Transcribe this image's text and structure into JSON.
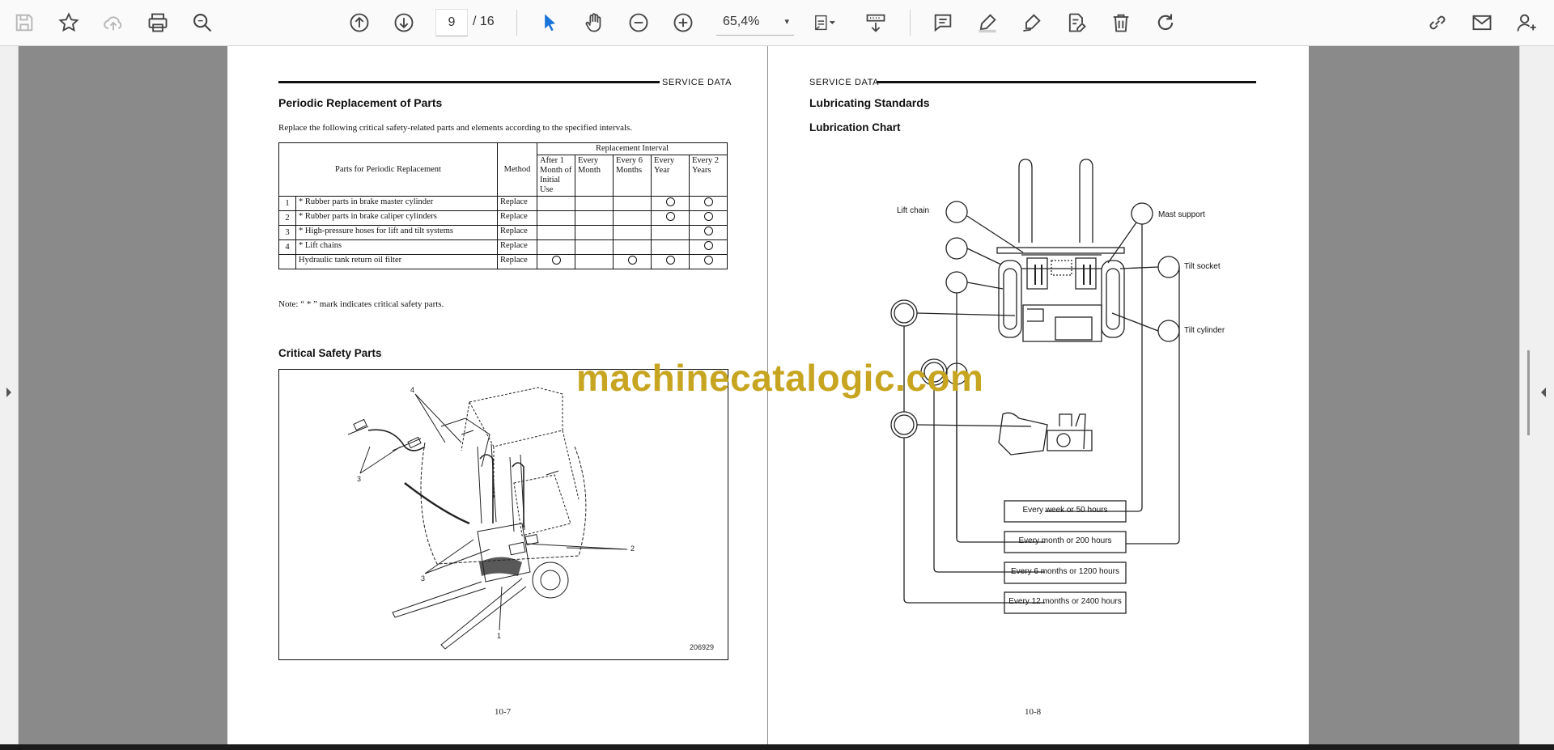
{
  "toolbar": {
    "current_page": "9",
    "page_total": "/  16",
    "zoom": "65,4%",
    "zoom_caret": "▾"
  },
  "left_page": {
    "header": "SERVICE  DATA",
    "title": "Periodic Replacement of Parts",
    "intro": "Replace the following critical safety-related parts and elements according to the specified intervals.",
    "table": {
      "col_parts": "Parts for Periodic Replacement",
      "col_method": "Method",
      "col_interval": "Replacement Interval",
      "intervals": [
        "After 1 Month of Initial Use",
        "Every Month",
        "Every 6 Months",
        "Every Year",
        "Every 2 Years"
      ],
      "rows": [
        {
          "no": "1",
          "part": "* Rubber parts in brake master cylinder",
          "method": "Replace",
          "marks": [
            false,
            false,
            false,
            true,
            true
          ]
        },
        {
          "no": "2",
          "part": "* Rubber parts in brake caliper cylinders",
          "method": "Replace",
          "marks": [
            false,
            false,
            false,
            true,
            true
          ]
        },
        {
          "no": "3",
          "part": "* High-pressure hoses for lift and tilt systems",
          "method": "Replace",
          "marks": [
            false,
            false,
            false,
            false,
            true
          ]
        },
        {
          "no": "4",
          "part": "* Lift chains",
          "method": "Replace",
          "marks": [
            false,
            false,
            false,
            false,
            true
          ]
        },
        {
          "no": "",
          "part": "Hydraulic tank return oil filter",
          "method": "Replace",
          "marks": [
            true,
            false,
            true,
            true,
            true
          ]
        }
      ]
    },
    "note": "Note:  “ * ” mark indicates critical safety parts.",
    "figure_title": "Critical Safety Parts",
    "figure_labels": {
      "l1": "1",
      "l2": "2",
      "l3a": "3",
      "l3b": "3",
      "l4": "4"
    },
    "figure_code": "206929",
    "page_number": "10-7"
  },
  "right_page": {
    "header": "SERVICE  DATA",
    "title": "Lubricating Standards",
    "subtitle": "Lubrication Chart",
    "callouts": {
      "lift_chain": "Lift chain",
      "mast_support": "Mast support",
      "tilt_socket": "Tilt socket",
      "tilt_cylinder": "Tilt cylinder"
    },
    "legend": [
      "Every week or 50 hours",
      "Every month or 200 hours",
      "Every 6 months or 1200 hours",
      "Every 12 months or 2400 hours"
    ],
    "page_number": "10-8"
  },
  "watermark": "machinecatalogic.com"
}
